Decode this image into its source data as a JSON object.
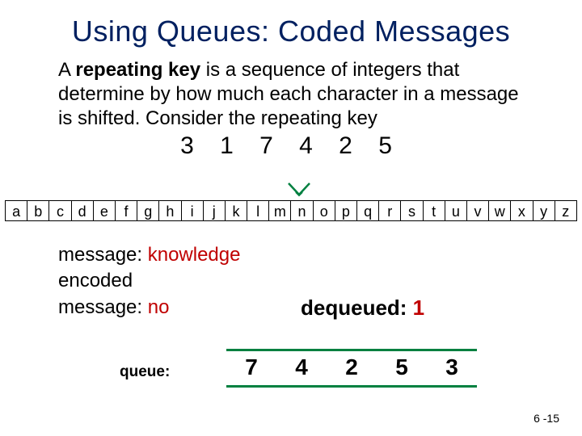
{
  "title": "Using Queues: Coded Messages",
  "para": {
    "prefix": "A ",
    "repeating_key": "repeating key",
    "rest": " is a sequence of integers that determine by how much each character in a message is shifted. Consider the repeating key"
  },
  "key_digits": "3 1 7 4 2 5",
  "alphabet": [
    "a",
    "b",
    "c",
    "d",
    "e",
    "f",
    "g",
    "h",
    "i",
    "j",
    "k",
    "l",
    "m",
    "n",
    "o",
    "p",
    "q",
    "r",
    "s",
    "t",
    "u",
    "v",
    "w",
    "x",
    "y",
    "z"
  ],
  "message": {
    "label": "message: ",
    "value": "knowledge"
  },
  "encoded": {
    "label1": "encoded",
    "label2": "message: ",
    "value": "no"
  },
  "dequeued": {
    "label": "dequeued: ",
    "value": "1"
  },
  "queue_label": "queue:",
  "queue_items": [
    "7",
    "4",
    "2",
    "5",
    "3"
  ],
  "slide_number": "6 -15"
}
